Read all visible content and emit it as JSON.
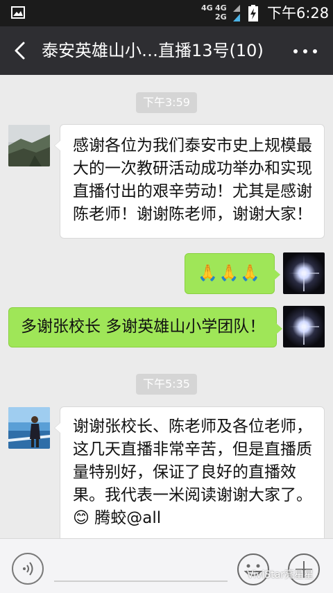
{
  "status_bar": {
    "network_top": "4G",
    "network_top2": "4G",
    "network_bottom": "2G",
    "time": "下午6:28"
  },
  "title_bar": {
    "title": "泰安英雄山小…直播13号(10)",
    "back_icon": "chevron-left-icon",
    "more_icon": "more-dots-icon"
  },
  "messages": [
    {
      "type": "time",
      "text": "下午3:59"
    },
    {
      "type": "message",
      "side": "left",
      "avatar": "mountain-photo",
      "text": "感谢各位为我们泰安市史上规模最\n大的一次教研活动成功举办和实现\n直播付出的艰辛劳动！尤其是感谢\n陈老师！谢谢陈老师，谢谢大家！"
    },
    {
      "type": "message",
      "side": "right",
      "avatar": "light-burst-photo",
      "text": "🙏🙏🙏"
    },
    {
      "type": "message",
      "side": "right",
      "avatar": "light-burst-photo",
      "text": "多谢张校长 多谢英雄山小学团队！"
    },
    {
      "type": "time",
      "text": "下午5:35"
    },
    {
      "type": "message",
      "side": "left",
      "avatar": "seaside-person-photo",
      "text": "谢谢张校长、陈老师及各位老师，\n这几天直播非常辛苦，但是直播质\n量特别好，保证了良好的直播效\n果。我代表一米阅读谢谢大家了。\n😊 腾蛟@all"
    }
  ],
  "input_bar": {
    "voice_icon": "voice-icon",
    "emoji_icon": "emoji-icon",
    "plus_icon": "plus-icon"
  },
  "watermark": "ViviStar亮星星",
  "colors": {
    "title_bar": "#2e2e32",
    "status_bar": "#1b1b1b",
    "chat_background": "#ebebeb",
    "sent_bubble": "#9fe658",
    "received_bubble": "#ffffff"
  }
}
